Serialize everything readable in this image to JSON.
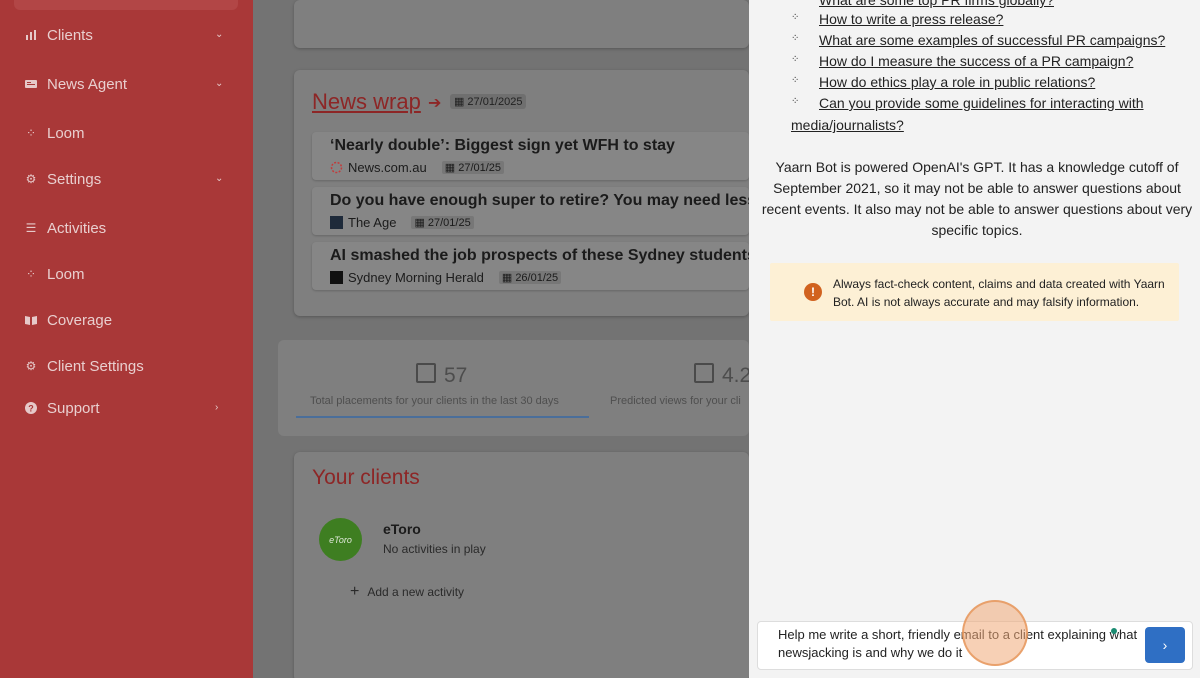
{
  "sidebar": {
    "items": [
      {
        "label": "Clients",
        "icon": "chart-icon",
        "has_chevron": true,
        "chevron": "down"
      },
      {
        "label": "News Agent",
        "icon": "newspaper-icon",
        "has_chevron": true,
        "chevron": "down"
      },
      {
        "label": "Loom",
        "icon": "loom-icon"
      },
      {
        "label": "Settings",
        "icon": "gear-icon",
        "has_chevron": true,
        "chevron": "down"
      },
      {
        "label": "Activities",
        "icon": "list-icon"
      },
      {
        "label": "Loom",
        "icon": "loom-icon"
      },
      {
        "label": "Coverage",
        "icon": "book-icon"
      },
      {
        "label": "Client Settings",
        "icon": "gear-icon"
      },
      {
        "label": "Support",
        "icon": "question-icon",
        "has_chevron": true,
        "chevron": "right"
      }
    ]
  },
  "news_wrap": {
    "title": "News wrap",
    "date": "27/01/2025",
    "articles": [
      {
        "headline": "‘Nearly double’: Biggest sign yet WFH to stay",
        "source": "News.com.au",
        "date": "27/01/25"
      },
      {
        "headline": "Do you have enough super to retire? You may need less t",
        "source": "The Age",
        "date": "27/01/25"
      },
      {
        "headline": "AI smashed the job prospects of these Sydney students. ",
        "source": "Sydney Morning Herald",
        "date": "26/01/25"
      }
    ]
  },
  "stats": {
    "placements_value": "57",
    "placements_label": "Total placements for your clients in the last 30 days",
    "views_value": "4.2",
    "views_label": "Predicted views for your cli"
  },
  "clients": {
    "title": "Your clients",
    "items": [
      {
        "name": "eToro",
        "subtitle": "No activities in play",
        "avatar_text": "eToro"
      }
    ],
    "add_activity": "Add a new activity"
  },
  "chat": {
    "questions": [
      "What are some top PR firms globally?",
      "How to write a press release?",
      "What are some examples of successful PR campaigns?",
      "How do I measure the success of a PR campaign?",
      "How do ethics play a role in public relations?",
      "Can you provide some guidelines for interacting with"
    ],
    "question_continuation": "media/journalists?",
    "info": "Yaarn Bot is powered OpenAI's GPT. It has a knowledge cutoff of September 2021, so it may not be able to answer questions about recent events. It also may not be able to answer questions about very specific topics.",
    "warning": "Always fact-check content, claims and data created with Yaarn Bot. AI is not always accurate and may falsify information.",
    "input_value": "Help me write a short, friendly email to a client explaining what newsjacking is and why we do it",
    "colors": {
      "send_button": "#2f6fc4",
      "warning_bg": "#fdf0d5",
      "warning_icon": "#d1621f"
    }
  },
  "colors": {
    "sidebar": "#a93838",
    "accent": "#8d2626"
  }
}
